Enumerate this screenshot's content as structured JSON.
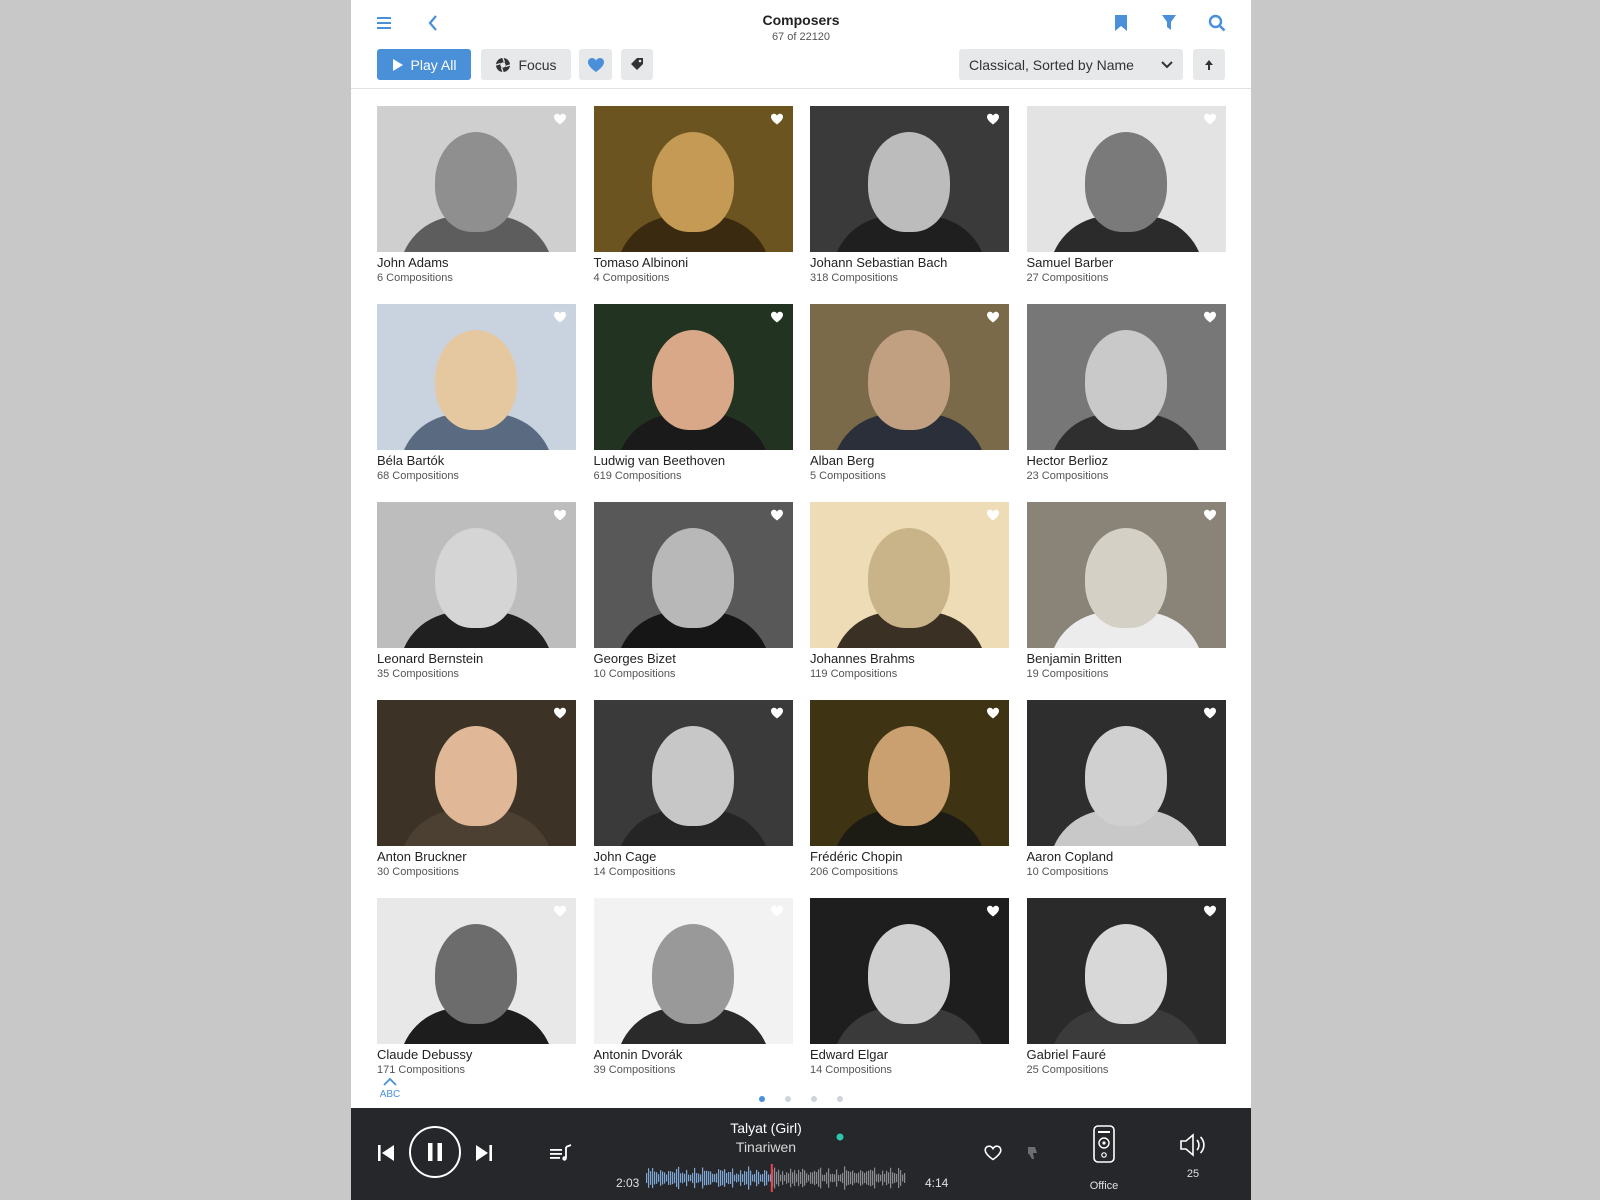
{
  "header": {
    "title": "Composers",
    "subtitle": "67 of 22120",
    "play_all_label": "Play All",
    "focus_label": "Focus",
    "sort_value": "Classical, Sorted by Name"
  },
  "composers": [
    {
      "name": "John Adams",
      "count": "6 Compositions"
    },
    {
      "name": "Tomaso Albinoni",
      "count": "4 Compositions"
    },
    {
      "name": "Johann Sebastian Bach",
      "count": "318 Compositions"
    },
    {
      "name": "Samuel Barber",
      "count": "27 Compositions"
    },
    {
      "name": "Béla Bartók",
      "count": "68 Compositions"
    },
    {
      "name": "Ludwig van Beethoven",
      "count": "619 Compositions"
    },
    {
      "name": "Alban Berg",
      "count": "5 Compositions"
    },
    {
      "name": "Hector Berlioz",
      "count": "23 Compositions"
    },
    {
      "name": "Leonard Bernstein",
      "count": "35 Compositions"
    },
    {
      "name": "Georges Bizet",
      "count": "10 Compositions"
    },
    {
      "name": "Johannes Brahms",
      "count": "119 Compositions"
    },
    {
      "name": "Benjamin Britten",
      "count": "19 Compositions"
    },
    {
      "name": "Anton Bruckner",
      "count": "30 Compositions"
    },
    {
      "name": "John Cage",
      "count": "14 Compositions"
    },
    {
      "name": "Frédéric Chopin",
      "count": "206 Compositions"
    },
    {
      "name": "Aaron Copland",
      "count": "10 Compositions"
    },
    {
      "name": "Claude Debussy",
      "count": "171 Compositions"
    },
    {
      "name": "Antonin Dvorák",
      "count": "39 Compositions"
    },
    {
      "name": "Edward Elgar",
      "count": "14 Compositions"
    },
    {
      "name": "Gabriel Fauré",
      "count": "25 Compositions"
    }
  ],
  "jump_label": "ABC",
  "player": {
    "track_title": "Talyat (Girl)",
    "artist": "Tinariwen",
    "elapsed": "2:03",
    "duration": "4:14",
    "progress": 0.48,
    "zone": "Office",
    "volume": "25"
  },
  "colors": {
    "accent": "#4a90d9",
    "player_bg": "#25272b"
  }
}
